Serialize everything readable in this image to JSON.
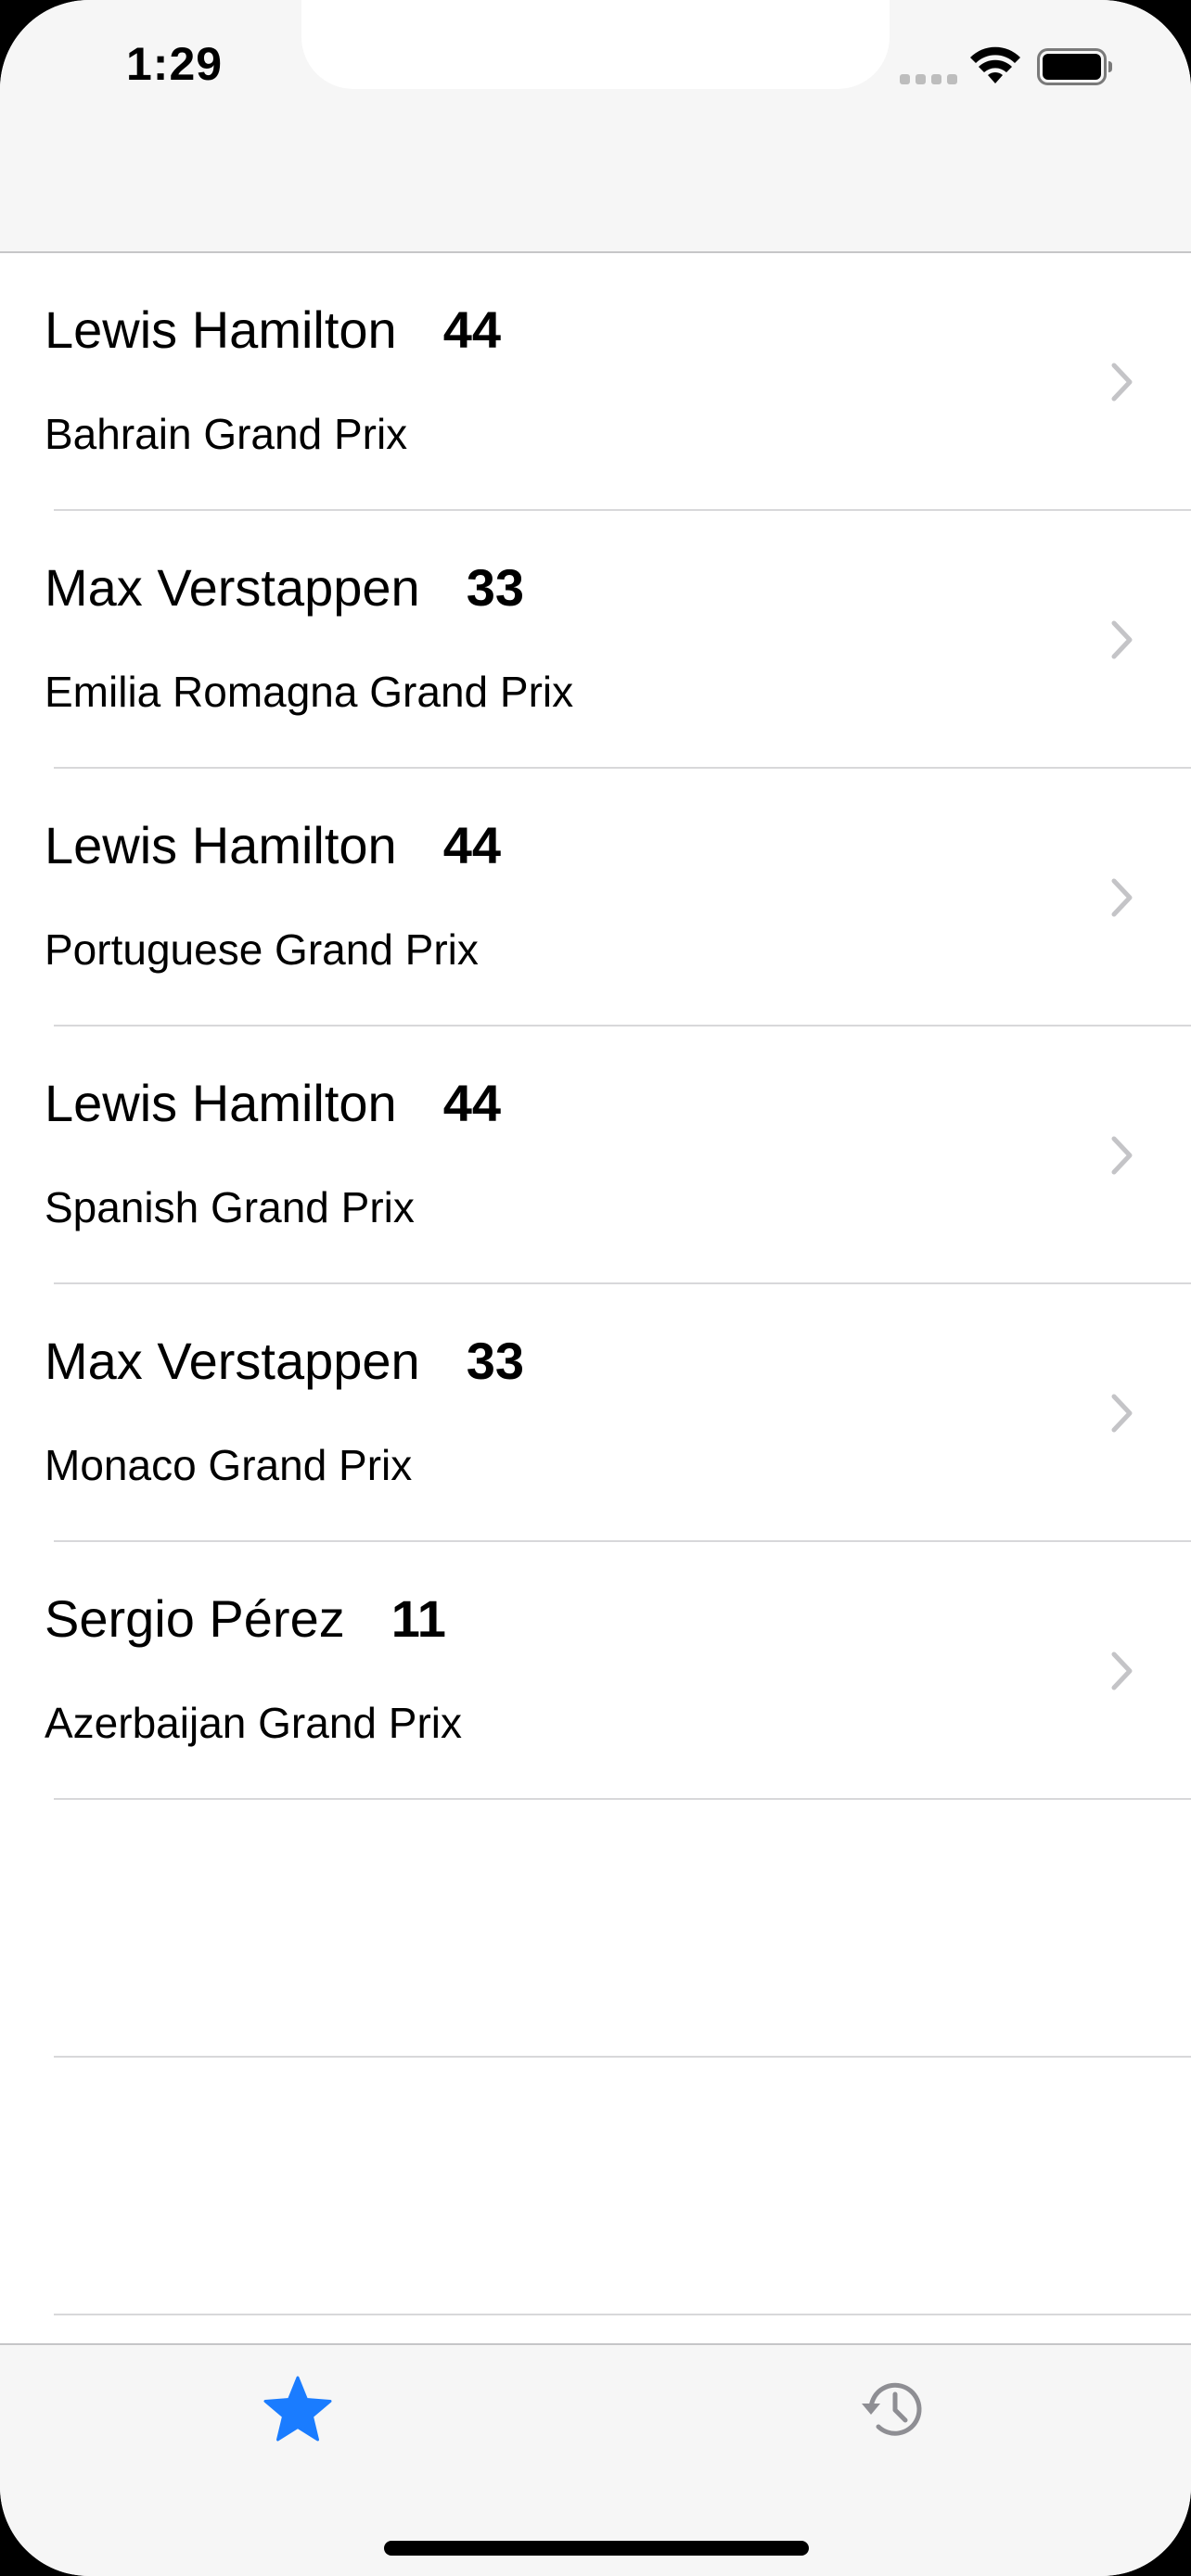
{
  "status_bar": {
    "time": "1:29"
  },
  "colors": {
    "accent": "#1a7cff",
    "inactive": "#8e8e93",
    "chevron": "#c4c4c7"
  },
  "races": [
    {
      "driver": "Lewis Hamilton",
      "number": "44",
      "race": "Bahrain Grand Prix"
    },
    {
      "driver": "Max Verstappen",
      "number": "33",
      "race": "Emilia Romagna Grand Prix"
    },
    {
      "driver": "Lewis Hamilton",
      "number": "44",
      "race": "Portuguese Grand Prix"
    },
    {
      "driver": "Lewis Hamilton",
      "number": "44",
      "race": "Spanish Grand Prix"
    },
    {
      "driver": "Max Verstappen",
      "number": "33",
      "race": "Monaco Grand Prix"
    },
    {
      "driver": "Sergio Pérez",
      "number": "11",
      "race": "Azerbaijan Grand Prix"
    }
  ],
  "tab_bar": {
    "tabs": [
      {
        "icon": "star-icon",
        "selected": true
      },
      {
        "icon": "history-icon",
        "selected": false
      }
    ]
  }
}
